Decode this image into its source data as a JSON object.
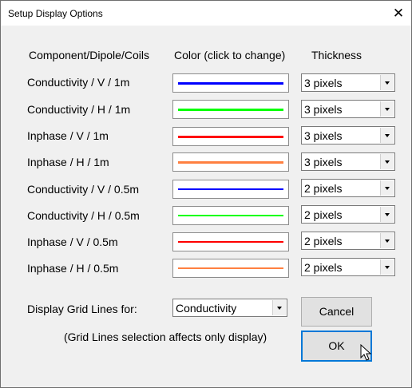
{
  "window": {
    "title": "Setup Display Options",
    "close_glyph": "✕"
  },
  "headers": {
    "component": "Component/Dipole/Coils",
    "color": "Color (click to change)",
    "thickness": "Thickness"
  },
  "rows": [
    {
      "label": "Conductivity / V / 1m",
      "color": "#0000ff",
      "thickness": "3 pixels"
    },
    {
      "label": "Conductivity / H / 1m",
      "color": "#00ff00",
      "thickness": "3 pixels"
    },
    {
      "label": "Inphase / V / 1m",
      "color": "#ff0000",
      "thickness": "3 pixels"
    },
    {
      "label": "Inphase / H / 1m",
      "color": "#ff8040",
      "thickness": "3 pixels"
    },
    {
      "label": "Conductivity / V / 0.5m",
      "color": "#0000ff",
      "thickness": "2 pixels"
    },
    {
      "label": "Conductivity / H / 0.5m",
      "color": "#00ff00",
      "thickness": "2 pixels"
    },
    {
      "label": "Inphase / V / 0.5m",
      "color": "#ff0000",
      "thickness": "2 pixels"
    },
    {
      "label": "Inphase / H / 0.5m",
      "color": "#ff8040",
      "thickness": "2 pixels"
    }
  ],
  "grid": {
    "label": "Display Grid Lines for:",
    "value": "Conductivity",
    "note": "(Grid Lines selection affects only display)"
  },
  "buttons": {
    "cancel": "Cancel",
    "ok": "OK"
  }
}
